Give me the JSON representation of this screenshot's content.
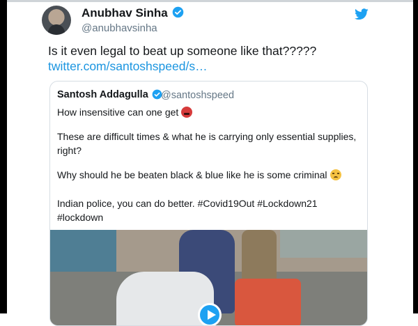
{
  "author": {
    "name": "Anubhav Sinha",
    "handle": "@anubhavsinha"
  },
  "tweet": {
    "text": "Is it even legal to beat up someone like that?????",
    "link": "twitter.com/santoshspeed/s…"
  },
  "quoted_tweet": {
    "name": "Santosh Addagulla",
    "handle": "@santoshspeed",
    "lines": [
      "How insensitive can one get",
      "These are difficult times & what he is carrying only essential supplies,",
      "right?",
      "Why should he be beaten black & blue like he is some criminal",
      "Indian police, you can do better. #Covid19Out #Lockdown21",
      "#lockdown"
    ]
  },
  "icons": {
    "brand": "twitter-bird-icon",
    "verified": "verified-badge-icon",
    "play": "play-icon",
    "emoji_1": "angry-face-emoji",
    "emoji_2": "sad-face-emoji"
  },
  "colors": {
    "brand_blue": "#1da1f2",
    "link_blue": "#1b95e0",
    "handle_grey": "#657786",
    "text": "#14171a"
  }
}
